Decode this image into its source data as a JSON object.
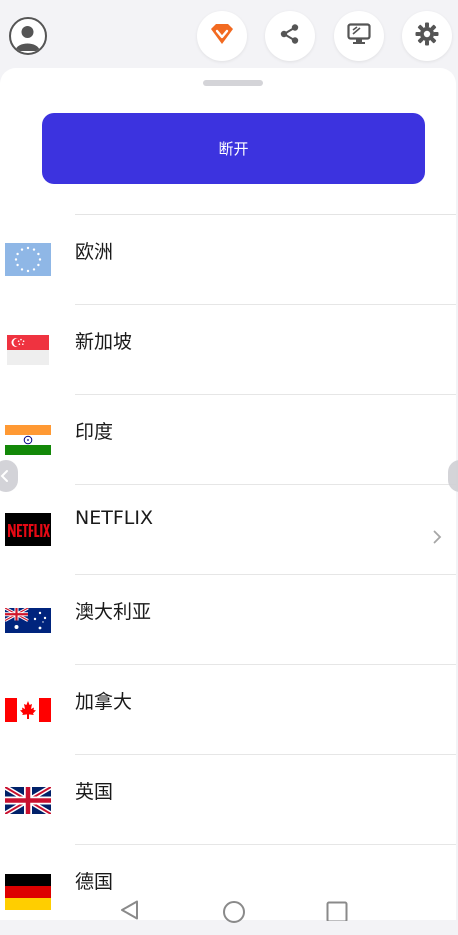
{
  "topbar": {
    "avatar_icon": "user-avatar-icon",
    "buttons": [
      {
        "name": "vip-badge",
        "icon": "diamond-v-icon",
        "color": "#f26a21"
      },
      {
        "name": "share",
        "icon": "share-icon"
      },
      {
        "name": "screen",
        "icon": "monitor-icon"
      },
      {
        "name": "settings",
        "icon": "gear-icon"
      }
    ]
  },
  "main": {
    "disconnect_label": "断开",
    "accent": "#3c33df"
  },
  "regions": [
    {
      "label": "欧洲",
      "flag": "eu-flag"
    },
    {
      "label": "新加坡",
      "flag": "singapore-flag"
    },
    {
      "label": "印度",
      "flag": "india-flag"
    },
    {
      "label": "NETFLIX",
      "flag": "netflix-logo",
      "has_chevron": true
    },
    {
      "label": "澳大利亚",
      "flag": "australia-flag"
    },
    {
      "label": "加拿大",
      "flag": "canada-flag"
    },
    {
      "label": "英国",
      "flag": "uk-flag"
    },
    {
      "label": "德国",
      "flag": "germany-flag"
    }
  ],
  "navbar": {
    "back": "back-triangle-icon",
    "home": "home-circle-icon",
    "recents": "recents-square-icon"
  }
}
